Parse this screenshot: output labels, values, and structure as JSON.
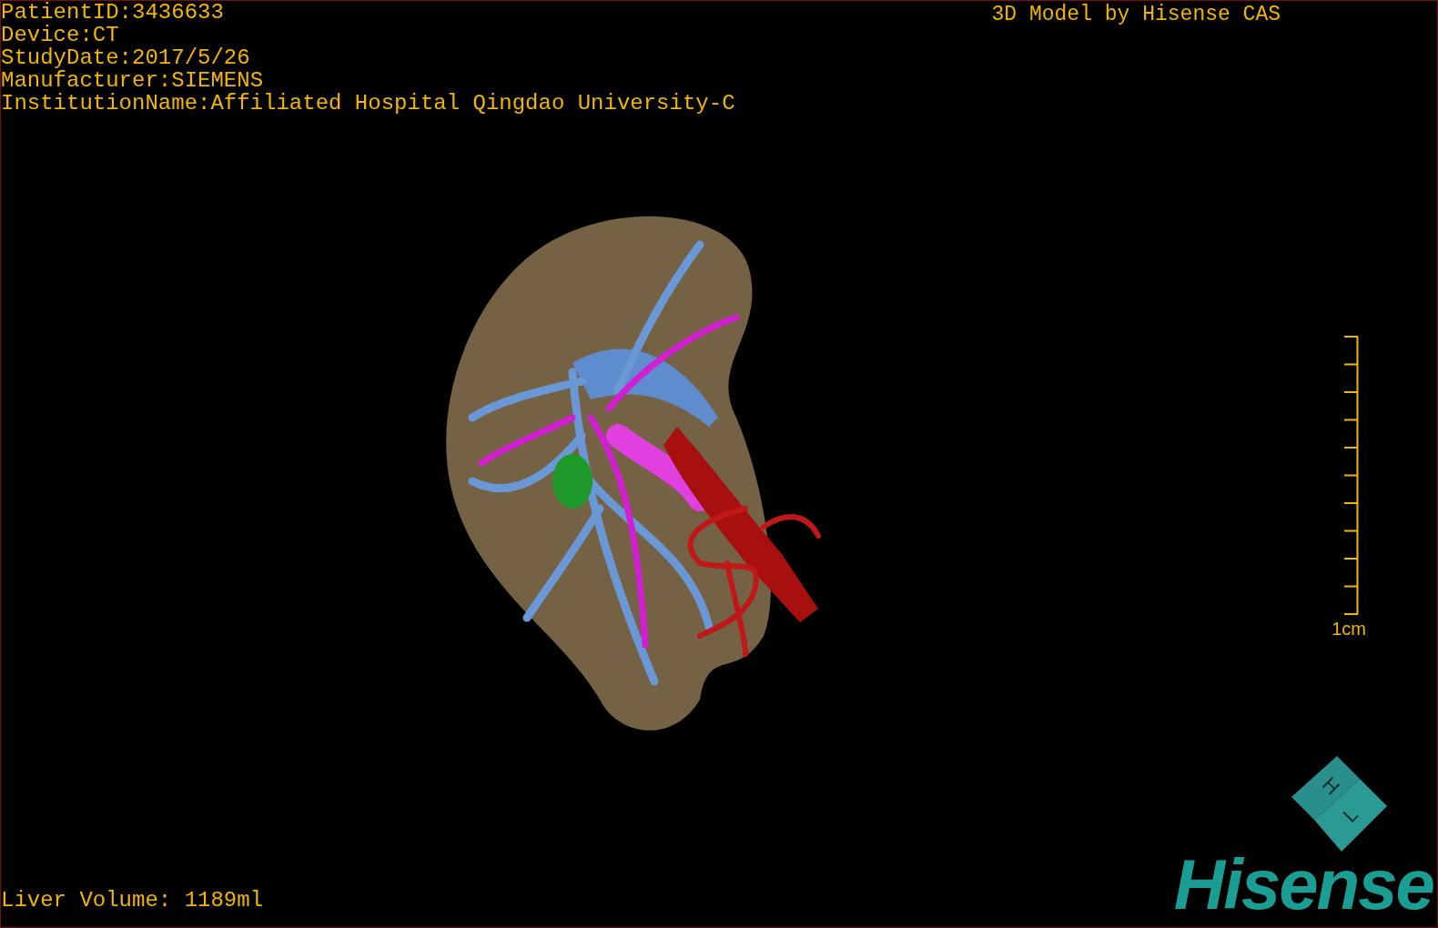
{
  "info": [
    "PatientID:3436633",
    "Device:CT",
    "StudyDate:2017/5/26",
    "Manufacturer:SIEMENS",
    "InstitutionName:Affiliated Hospital Qingdao University-C"
  ],
  "title": "3D Model by Hisense CAS",
  "scale": {
    "label": "1cm"
  },
  "orientation_cube": {
    "labels": [
      "H",
      "L"
    ]
  },
  "liver_volume": "Liver Volume: 1189ml",
  "logo": "Hisense"
}
